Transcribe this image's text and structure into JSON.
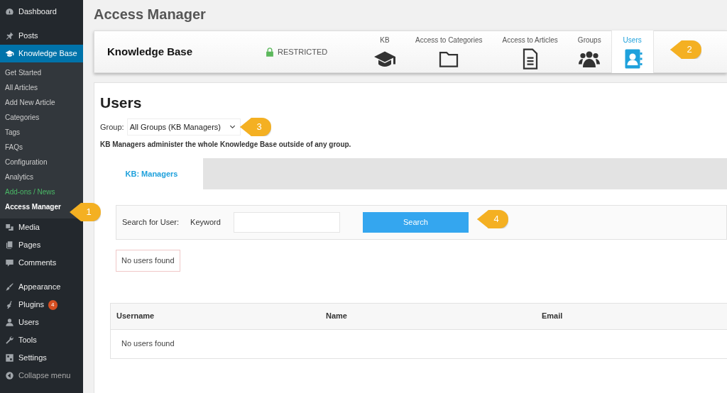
{
  "sidebar": {
    "items": [
      {
        "label": "Dashboard",
        "selected": false
      },
      {
        "label": "Posts",
        "selected": false
      },
      {
        "label": "Knowledge Base",
        "selected": true,
        "children": [
          {
            "label": "Get Started",
            "kind": "link",
            "selected": false
          },
          {
            "label": "All Articles",
            "kind": "link",
            "selected": false
          },
          {
            "label": "Add New Article",
            "kind": "link",
            "selected": false
          },
          {
            "label": "Categories",
            "kind": "link",
            "selected": false
          },
          {
            "label": "Tags",
            "kind": "link",
            "selected": false
          },
          {
            "label": "FAQs",
            "kind": "link",
            "selected": false
          },
          {
            "label": "Configuration",
            "kind": "link",
            "selected": false
          },
          {
            "label": "Analytics",
            "kind": "link",
            "selected": false
          },
          {
            "label": "Add-ons / News",
            "kind": "addon",
            "selected": false
          },
          {
            "label": "Access Manager",
            "kind": "link",
            "selected": true
          }
        ]
      },
      {
        "label": "Media",
        "selected": false
      },
      {
        "label": "Pages",
        "selected": false
      },
      {
        "label": "Comments",
        "selected": false
      },
      {
        "label": "Appearance",
        "selected": false
      },
      {
        "label": "Plugins",
        "badge": "4",
        "selected": false
      },
      {
        "label": "Users",
        "selected": false
      },
      {
        "label": "Tools",
        "selected": false
      },
      {
        "label": "Settings",
        "selected": false
      },
      {
        "label": "Collapse menu",
        "selected": false
      }
    ]
  },
  "page_title": "Access Manager",
  "header": {
    "title": "Knowledge Base",
    "status": "RESTRICTED",
    "tabs": [
      {
        "label": "KB",
        "selected": false
      },
      {
        "label": "Access to Categories",
        "selected": false
      },
      {
        "label": "Access to Articles",
        "selected": false
      },
      {
        "label": "Groups",
        "selected": false
      },
      {
        "label": "Users",
        "selected": true
      }
    ]
  },
  "users": {
    "heading": "Users",
    "group_label": "Group:",
    "group_value": "All Groups (KB Managers)",
    "description": "KB Managers administer the whole Knowledge Base outside of any group.",
    "tabs": [
      {
        "label": "KB: Managers",
        "selected": true
      }
    ],
    "search_label": "Search for User:",
    "keyword_label": "Keyword",
    "search_button": "Search",
    "message": "No users found",
    "table": {
      "columns": [
        "Username",
        "Name",
        "Email"
      ],
      "empty": "No users found"
    }
  },
  "callouts": [
    "1",
    "2",
    "3",
    "4"
  ]
}
